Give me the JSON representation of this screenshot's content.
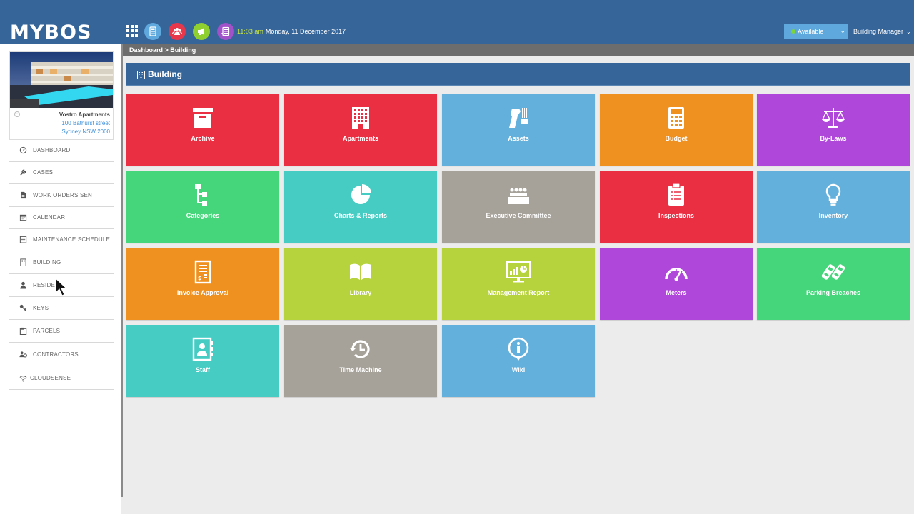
{
  "header": {
    "logo": "MYBOS",
    "time": "11:03 am",
    "date": "Monday, 11 December 2017",
    "status": "Available",
    "role": "Building Manager",
    "buttons": [
      {
        "name": "calculator-button",
        "icon": "calculator-icon",
        "color": "#5ea8dd"
      },
      {
        "name": "team-button",
        "icon": "team-icon",
        "color": "#e6374b"
      },
      {
        "name": "announcement-button",
        "icon": "megaphone-icon",
        "color": "#8fcf2f"
      },
      {
        "name": "notes-button",
        "icon": "notes-icon",
        "color": "#a052c8"
      }
    ]
  },
  "building": {
    "name": "Vostro Apartments",
    "address_line1": "100 Bathurst street",
    "address_line2": "Sydney NSW 2000"
  },
  "sidebar": {
    "items": [
      {
        "label": "DASHBOARD",
        "icon": "dashboard-icon"
      },
      {
        "label": "CASES",
        "icon": "wrench-icon"
      },
      {
        "label": "WORK ORDERS SENT",
        "icon": "document-icon"
      },
      {
        "label": "CALENDAR",
        "icon": "calendar-icon"
      },
      {
        "label": "MAINTENANCE SCHEDULE",
        "icon": "schedule-icon"
      },
      {
        "label": "BUILDING",
        "icon": "building-icon"
      },
      {
        "label": "RESIDEN",
        "icon": "person-icon"
      },
      {
        "label": "KEYS",
        "icon": "key-icon"
      },
      {
        "label": "PARCELS",
        "icon": "parcel-icon"
      },
      {
        "label": "CONTRACTORS",
        "icon": "contractors-icon"
      },
      {
        "label": "CLOUDSENSE",
        "icon": "wifi-icon"
      }
    ]
  },
  "breadcrumb": "Dashboard > Building",
  "panel": {
    "title": "Building"
  },
  "tiles": [
    {
      "label": "Archive",
      "icon": "archive-box-icon",
      "color": "#ea2f43"
    },
    {
      "label": "Apartments",
      "icon": "apartment-building-icon",
      "color": "#ea2f43"
    },
    {
      "label": "Assets",
      "icon": "barcode-scanner-icon",
      "color": "#64b0dc"
    },
    {
      "label": "Budget",
      "icon": "calculator-icon",
      "color": "#ee9121"
    },
    {
      "label": "By-Laws",
      "icon": "scales-icon",
      "color": "#af47da"
    },
    {
      "label": "Categories",
      "icon": "hierarchy-icon",
      "color": "#45d57a"
    },
    {
      "label": "Charts & Reports",
      "icon": "pie-chart-icon",
      "color": "#46ccc3"
    },
    {
      "label": "Executive Committee",
      "icon": "committee-icon",
      "color": "#a6a199"
    },
    {
      "label": "Inspections",
      "icon": "clipboard-icon",
      "color": "#ea2f43"
    },
    {
      "label": "Inventory",
      "icon": "lightbulb-icon",
      "color": "#64b0dc"
    },
    {
      "label": "Invoice Approval",
      "icon": "invoice-icon",
      "color": "#ee9121"
    },
    {
      "label": "Library",
      "icon": "book-icon",
      "color": "#b6d23c"
    },
    {
      "label": "Management Report",
      "icon": "monitor-report-icon",
      "color": "#b6d23c"
    },
    {
      "label": "Meters",
      "icon": "gauge-icon",
      "color": "#af47da"
    },
    {
      "label": "Parking Breaches",
      "icon": "parking-cars-icon",
      "color": "#45d57a"
    },
    {
      "label": "Staff",
      "icon": "contact-book-icon",
      "color": "#46ccc3"
    },
    {
      "label": "Time Machine",
      "icon": "history-icon",
      "color": "#a6a199"
    },
    {
      "label": "Wiki",
      "icon": "info-icon",
      "color": "#64b0dc"
    }
  ]
}
